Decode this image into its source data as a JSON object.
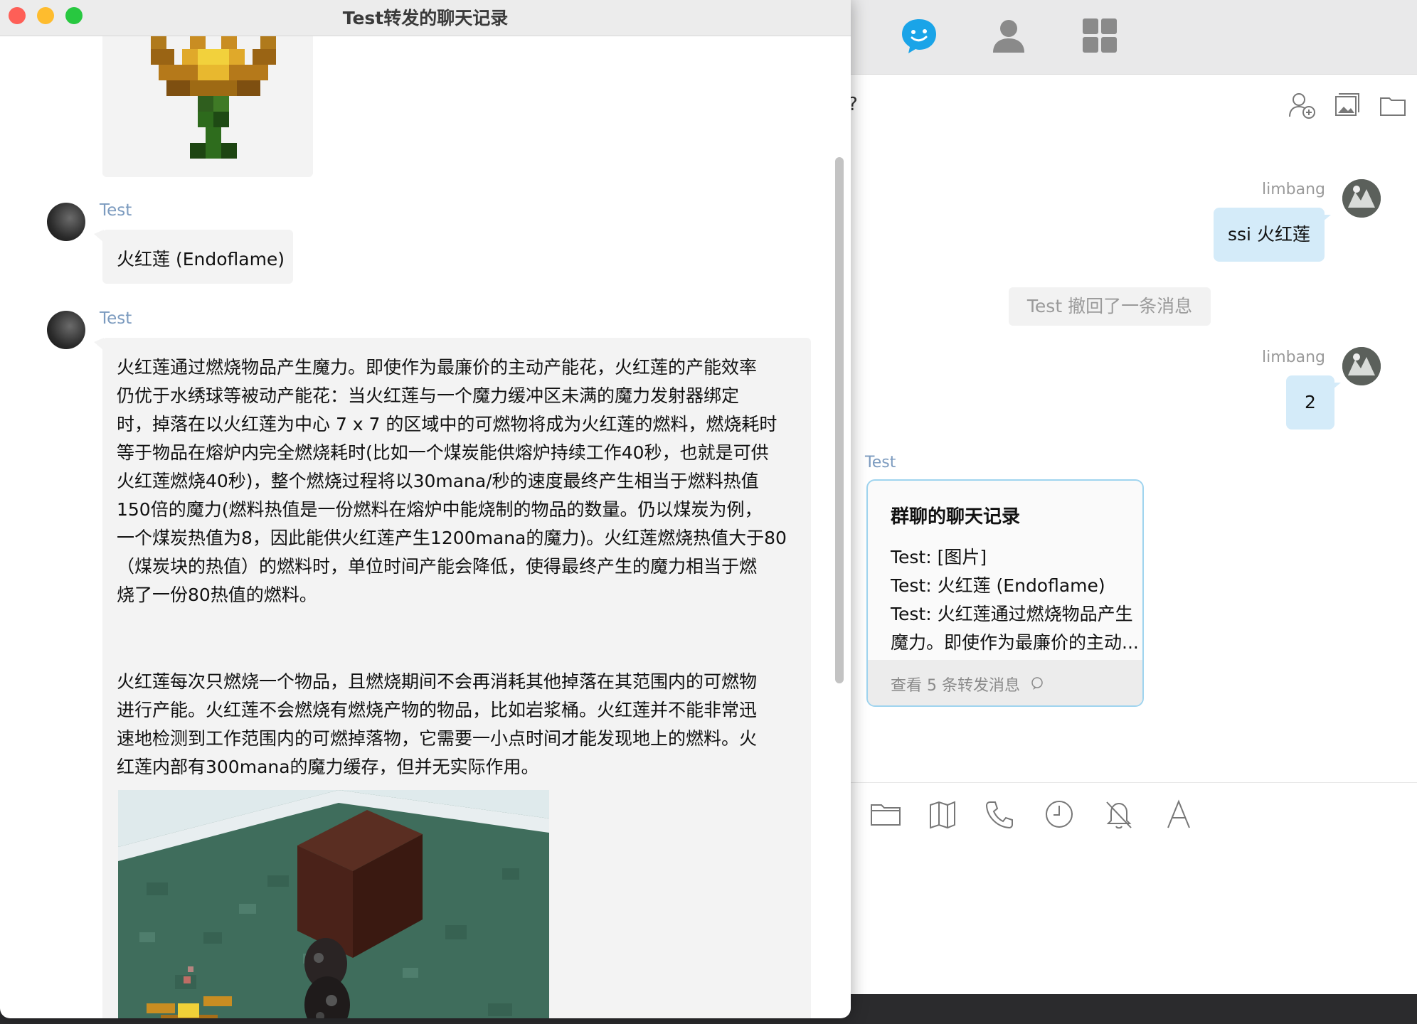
{
  "window": {
    "title": "Test转发的聊天记录"
  },
  "forwarded": {
    "messages": [
      {
        "sender": "Test",
        "text": "火红莲 (Endoflame)"
      },
      {
        "sender": "Test",
        "lines": [
          "火红莲通过燃烧物品产生魔力。即使作为最廉价的主动产能花，火红莲的产能效率",
          "仍优于水绣球等被动产能花：当火红莲与一个魔力缓冲区未满的魔力发射器绑定",
          "时，掉落在以火红莲为中心 7 x 7 的区域中的可燃物将成为火红莲的燃料，燃烧耗时",
          "等于物品在熔炉内完全燃烧耗时(比如一个煤炭能供熔炉持续工作40秒，也就是可供",
          "火红莲燃烧40秒)，整个燃烧过程将以30mana/秒的速度最终产生相当于燃料热值",
          "150倍的魔力(燃料热值是一份燃料在熔炉中能烧制的物品的数量。仍以煤炭为例，",
          "一个煤炭热值为8，因此能供火红莲产生1200mana的魔力)。火红莲燃烧热值大于80",
          "（煤炭块的热值）的燃料时，单位时间产能会降低，使得最终产生的魔力相当于燃",
          "烧了一份80热值的燃料。"
        ],
        "lines2": [
          "火红莲每次只燃烧一个物品，且燃烧期间不会再消耗其他掉落在其范围内的可燃物",
          "进行产能。火红莲不会燃烧有燃烧产物的物品，比如岩浆桶。火红莲并不能非常迅",
          "速地检测到工作范围内的可燃掉落物，它需要一小点时间才能发现地上的燃料。火",
          "红莲内部有300mana的魔力缓存，但并无实际作用。"
        ]
      }
    ]
  },
  "chat": {
    "header_text": "?",
    "messages": [
      {
        "sender": "limbang",
        "text": "ssi 火红莲"
      },
      {
        "system": "Test 撤回了一条消息"
      },
      {
        "sender": "limbang",
        "text": "2"
      }
    ],
    "forward_card": {
      "sender": "Test",
      "title": "群聊的聊天记录",
      "lines": [
        "Test: [图片]",
        "Test: 火红莲 (Endoflame)",
        "Test: 火红莲通过燃烧物品产生",
        "魔力。即使作为最廉价的主动..."
      ],
      "footer": "查看 5 条转发消息"
    }
  },
  "colors": {
    "accent": "#1aa4e8",
    "bubble_me": "#d4ebf9",
    "card_border": "#9fd4ef",
    "sender_name_fg": "#7c9bbf"
  },
  "icons": {
    "nav": [
      "chat-icon",
      "contacts-icon",
      "apps-icon"
    ],
    "header": [
      "add-member-icon",
      "image-icon",
      "folder-icon"
    ],
    "toolbar": [
      "scissors-icon",
      "folder-icon",
      "sticker-icon",
      "phone-icon",
      "clock-icon",
      "mute-bell-icon",
      "font-icon"
    ]
  }
}
